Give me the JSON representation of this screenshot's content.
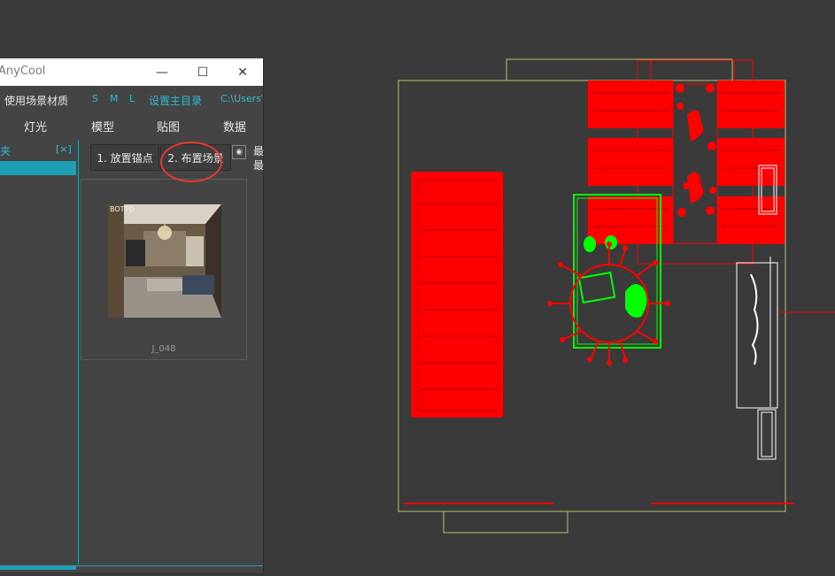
{
  "window": {
    "title": "AnyCool",
    "minimize_glyph": "—",
    "maximize_glyph": "☐",
    "close_glyph": "✕"
  },
  "toolbar": {
    "material_label": "使用场景材质",
    "size_s": "S",
    "size_m": "M",
    "size_l": "L",
    "set_root_label": "设置主目录",
    "path_text": "C:\\Users\\"
  },
  "tabs": [
    "灯光",
    "模型",
    "贴图",
    "数据"
  ],
  "sidebar": {
    "folder_label": "夹",
    "close_label": "[×]"
  },
  "actions": {
    "place_anchor": "1. 放置锚点",
    "arrange_scene": "2. 布置场景",
    "extra_1": "最",
    "extra_2": "最"
  },
  "thumbnail": {
    "caption": "J_048",
    "overlay_text": "BOTTO"
  },
  "colors": {
    "viewport_bg": "#3a3a3a",
    "panel_bg": "#444444",
    "accent": "#1f9fb6",
    "highlight_circle": "#e03a30",
    "wire_red": "#ff0000",
    "wire_green": "#00ff00",
    "wire_olive": "#b5c46a",
    "wire_white": "#ffffff"
  }
}
